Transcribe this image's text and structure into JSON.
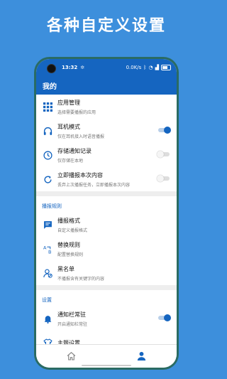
{
  "promo": {
    "title": "各种自定义设置"
  },
  "status_bar": {
    "time": "13:32",
    "network": "0.0K/s",
    "battery": "99"
  },
  "app_bar": {
    "title": "我的"
  },
  "general_items": [
    {
      "title": "应用管理",
      "subtitle": "选择需要播报的应用",
      "icon": "grid-icon"
    },
    {
      "title": "耳机模式",
      "subtitle": "仅在耳机接入时语音播报",
      "icon": "headphones-icon",
      "toggle": true
    },
    {
      "title": "存储通知记录",
      "subtitle": "仅存储在本地",
      "icon": "clock-icon",
      "toggle": false
    },
    {
      "title": "立即播报本次内容",
      "subtitle": "丢弃上次播报任务，立即播报本次内容",
      "icon": "refresh-icon",
      "toggle": false
    }
  ],
  "broadcast_section": {
    "label": "播报规则",
    "items": [
      {
        "title": "播报格式",
        "subtitle": "自定义播报格式",
        "icon": "message-icon"
      },
      {
        "title": "替换规则",
        "subtitle": "配置替换规则",
        "icon": "replace-icon"
      },
      {
        "title": "黑名单",
        "subtitle": "不播报含有关键字的内容",
        "icon": "block-user-icon"
      }
    ]
  },
  "settings_section": {
    "label": "设置",
    "items": [
      {
        "title": "通知栏常驻",
        "subtitle": "开启通知栏常驻",
        "icon": "bell-icon",
        "toggle": true
      },
      {
        "title": "主题设置",
        "subtitle": "",
        "icon": "shirt-icon"
      }
    ]
  },
  "bottom_nav": [
    {
      "icon": "home-icon",
      "active": false
    },
    {
      "icon": "person-icon",
      "active": true
    }
  ],
  "colors": {
    "primary": "#1565c0",
    "background": "#3d8fdc"
  }
}
